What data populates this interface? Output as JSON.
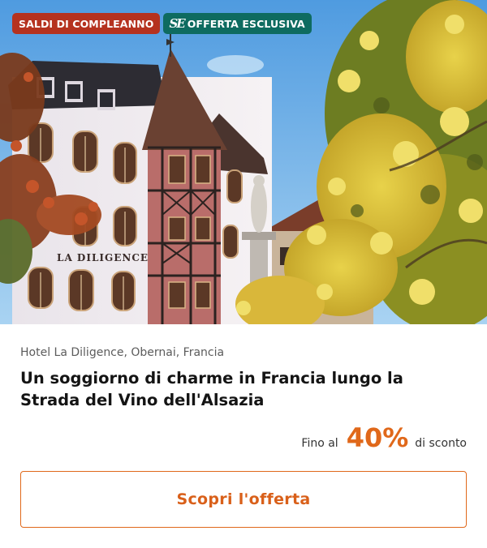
{
  "badges": {
    "sale": "SALDI DI COMPLEANNO",
    "exclusive_logo": "SE",
    "exclusive": "OFFERTA ESCLUSIVA"
  },
  "hero": {
    "image_subject": "hotel-facade-photo",
    "sign_text": "LA DILIGENCE"
  },
  "offer": {
    "location": "Hotel La Diligence, Obernai, Francia",
    "title": "Un soggiorno di charme in Francia lungo la Strada del Vino dell'Alsazia",
    "discount_prefix": "Fino al",
    "discount_value": "40%",
    "discount_suffix": "di sconto",
    "cta_label": "Scopri l'offerta"
  },
  "colors": {
    "sale_badge": "#b5321f",
    "exclusive_badge": "#0e6b60",
    "accent": "#e0681a"
  }
}
